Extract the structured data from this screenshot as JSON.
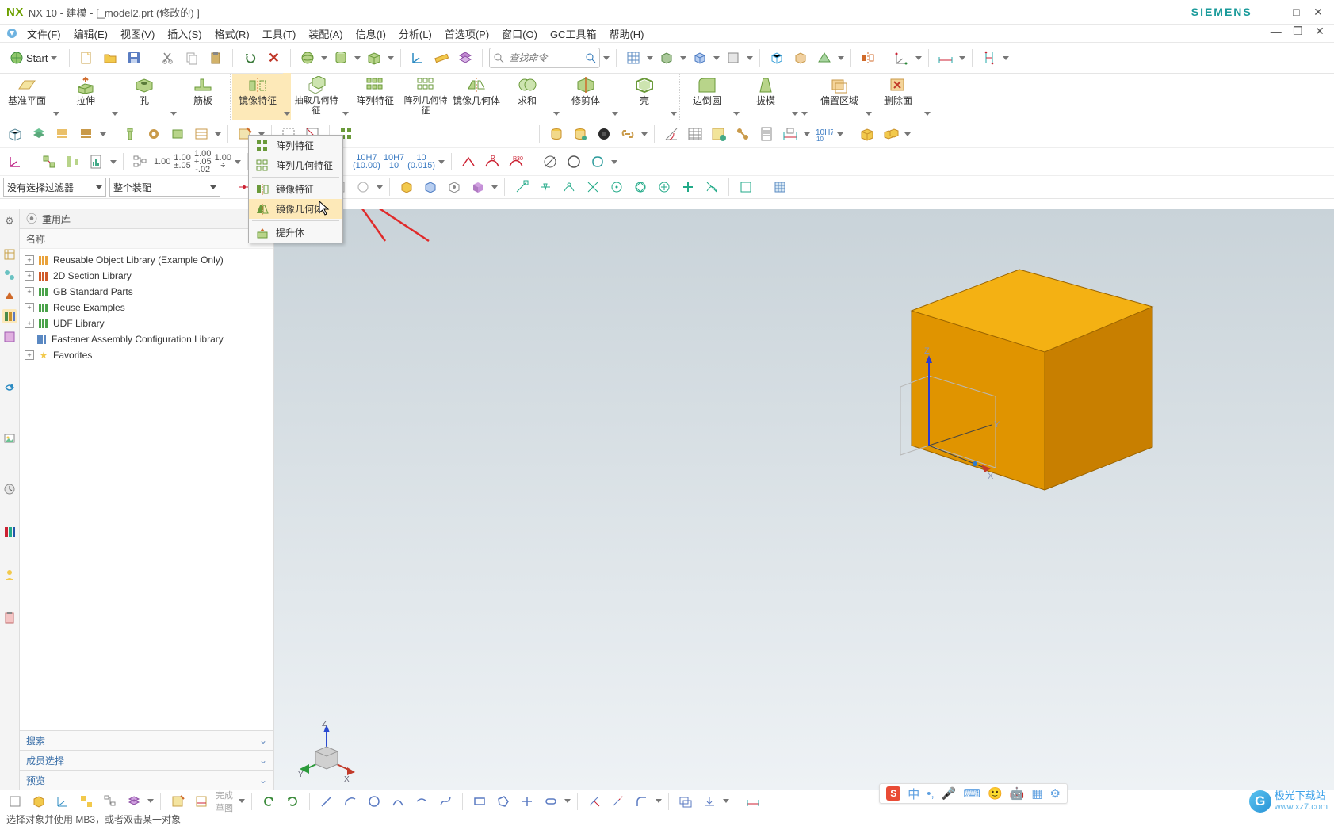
{
  "titlebar": {
    "logo": "NX",
    "title": "NX 10 - 建模 - [_model2.prt  (修改的) ]",
    "brand": "SIEMENS"
  },
  "menubar": {
    "items": [
      "文件(F)",
      "编辑(E)",
      "视图(V)",
      "插入(S)",
      "格式(R)",
      "工具(T)",
      "装配(A)",
      "信息(I)",
      "分析(L)",
      "首选项(P)",
      "窗口(O)",
      "GC工具箱",
      "帮助(H)"
    ]
  },
  "toolbar1": {
    "start": "Start",
    "finder_placeholder": "查找命令"
  },
  "ribbon": {
    "groups": [
      {
        "items": [
          {
            "label": "基准平面"
          },
          {
            "label": "拉伸"
          },
          {
            "label": "孔"
          },
          {
            "label": "筋板"
          }
        ]
      },
      {
        "items": [
          {
            "label": "镜像特征",
            "active": true
          },
          {
            "label": "抽取几何特征"
          },
          {
            "label": "阵列特征"
          },
          {
            "label": "阵列几何特征"
          },
          {
            "label": "镜像几何体"
          },
          {
            "label": "求和"
          },
          {
            "label": "修剪体"
          },
          {
            "label": "壳"
          }
        ]
      },
      {
        "items": [
          {
            "label": "边倒圆"
          },
          {
            "label": "拔模"
          }
        ]
      },
      {
        "items": [
          {
            "label": "偏置区域"
          },
          {
            "label": "删除面"
          }
        ]
      }
    ]
  },
  "numrow": {
    "vals": [
      "1.00",
      "1.00\n±.05",
      "1.00\n+.05\n-.02",
      "1.00\n÷"
    ]
  },
  "tolrow": {
    "vals": [
      "10H7\n(10.00)",
      "10H7\n10",
      "10\n(0.015)"
    ]
  },
  "filter_row": {
    "sel1": "没有选择过滤器",
    "sel2": "整个装配"
  },
  "dropdown": {
    "items": [
      "阵列特征",
      "阵列几何特征",
      "镜像特征",
      "镜像几何体",
      "提升体"
    ],
    "hover_index": 3
  },
  "panel": {
    "title": "重用库",
    "column": "名称",
    "tree": [
      {
        "label": "Reusable Object Library (Example Only)",
        "color": "#e9a23b"
      },
      {
        "label": "2D Section Library",
        "color": "#d05a2a"
      },
      {
        "label": "GB Standard Parts",
        "color": "#4aa34a"
      },
      {
        "label": "Reuse Examples",
        "color": "#4aa34a"
      },
      {
        "label": "UDF Library",
        "color": "#4aa34a"
      },
      {
        "label": "Fastener Assembly Configuration Library",
        "color": "#5a88c2",
        "plus": false
      },
      {
        "label": "Favorites",
        "color": "#f2c94c"
      }
    ],
    "sections": [
      "搜索",
      "成员选择",
      "预览"
    ]
  },
  "viewport": {
    "axis_labels": {
      "x": "X",
      "y": "Y",
      "z": "Z"
    },
    "triad_labels": {
      "x": "X",
      "y": "Y",
      "z": "Z"
    }
  },
  "ime": {
    "icons": [
      "中",
      "•,",
      "🎤",
      "⌨",
      "🙂",
      "🤖",
      "▦",
      "⚙"
    ]
  },
  "watermark": {
    "name": "极光下载站",
    "url": "www.xz7.com"
  },
  "status": {
    "msg": "选择对象并使用 MB3，或者双击某一对象"
  }
}
